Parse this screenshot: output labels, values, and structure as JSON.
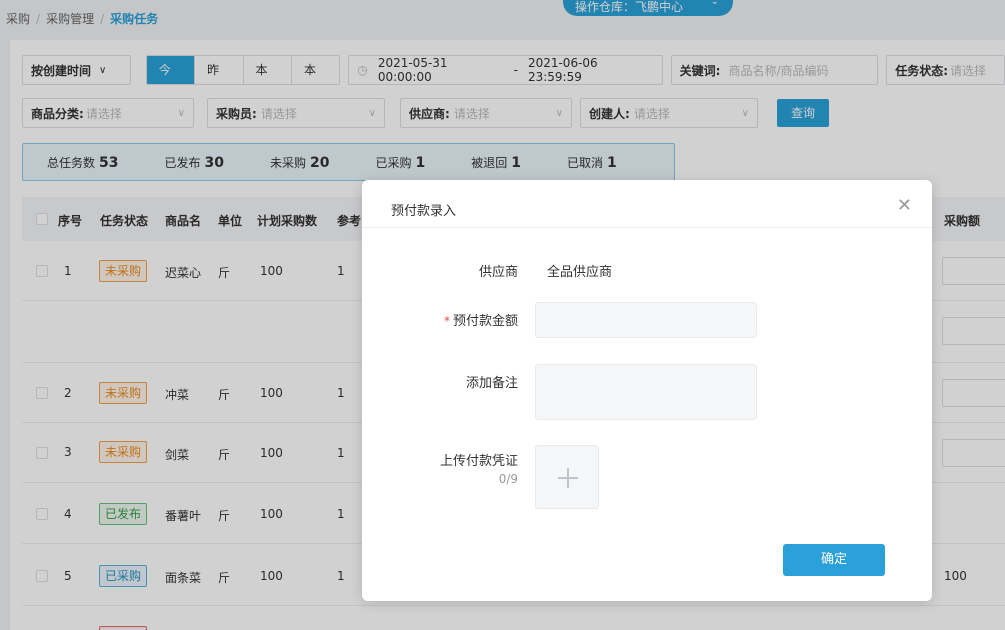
{
  "breadcrumb": [
    "采购",
    "采购管理",
    "采购任务"
  ],
  "warehouse": {
    "label": "操作仓库：飞鹏中心"
  },
  "filters": {
    "sort_by": "按创建时间",
    "date_buttons": [
      "今日",
      "昨日",
      "本周",
      "本月"
    ],
    "active_date_button": "今日",
    "date_start": "2021-05-31 00:00:00",
    "date_sep": "-",
    "date_end": "2021-06-06 23:59:59",
    "keyword_label": "关键词:",
    "keyword_placeholder": "商品名称/商品编码",
    "task_status_label": "任务状态:",
    "task_status_placeholder": "请选择",
    "category_label": "商品分类:",
    "category_placeholder": "请选择",
    "buyer_label": "采购员:",
    "buyer_placeholder": "请选择",
    "supplier_label": "供应商:",
    "supplier_placeholder": "请选择",
    "creator_label": "创建人:",
    "creator_placeholder": "请选择",
    "query_button": "查询"
  },
  "stats": [
    {
      "label": "总任务数",
      "value": "53"
    },
    {
      "label": "已发布",
      "value": "30"
    },
    {
      "label": "未采购",
      "value": "20"
    },
    {
      "label": "已采购",
      "value": "1"
    },
    {
      "label": "被退回",
      "value": "1"
    },
    {
      "label": "已取消",
      "value": "1"
    }
  ],
  "table": {
    "headers": [
      "序号",
      "任务状态",
      "商品名",
      "单位",
      "计划采购数",
      "参考",
      "采购额"
    ],
    "rows": [
      {
        "no": "1",
        "status": "未采购",
        "status_color": "orange",
        "name": "迟菜心",
        "unit": "斤",
        "plan": "100",
        "ref": "1",
        "amount": ""
      },
      {
        "no": "2",
        "status": "未采购",
        "status_color": "orange",
        "name": "冲菜",
        "unit": "斤",
        "plan": "100",
        "ref": "1",
        "amount": ""
      },
      {
        "no": "3",
        "status": "未采购",
        "status_color": "orange",
        "name": "剑菜",
        "unit": "斤",
        "plan": "100",
        "ref": "1",
        "amount": ""
      },
      {
        "no": "4",
        "status": "已发布",
        "status_color": "green",
        "name": "番薯叶",
        "unit": "斤",
        "plan": "100",
        "ref": "1",
        "amount": ""
      },
      {
        "no": "5",
        "status": "已采购",
        "status_color": "blue",
        "name": "面条菜",
        "unit": "斤",
        "plan": "100",
        "ref": "1",
        "amount": "100"
      }
    ]
  },
  "dialog": {
    "title": "预付款录入",
    "supplier_label": "供应商",
    "supplier_value": "全品供应商",
    "prepay_label": "预付款金额",
    "prepay_required_mark": "*",
    "note_label": "添加备注",
    "upload_label": "上传付款凭证",
    "upload_count": "0/9",
    "confirm_button": "确定"
  },
  "colors": {
    "accent": "#2aa1d8",
    "orange": "#e88a1f",
    "green": "#3a9a4a",
    "blue": "#2a8ec4",
    "red": "#dd3333"
  }
}
